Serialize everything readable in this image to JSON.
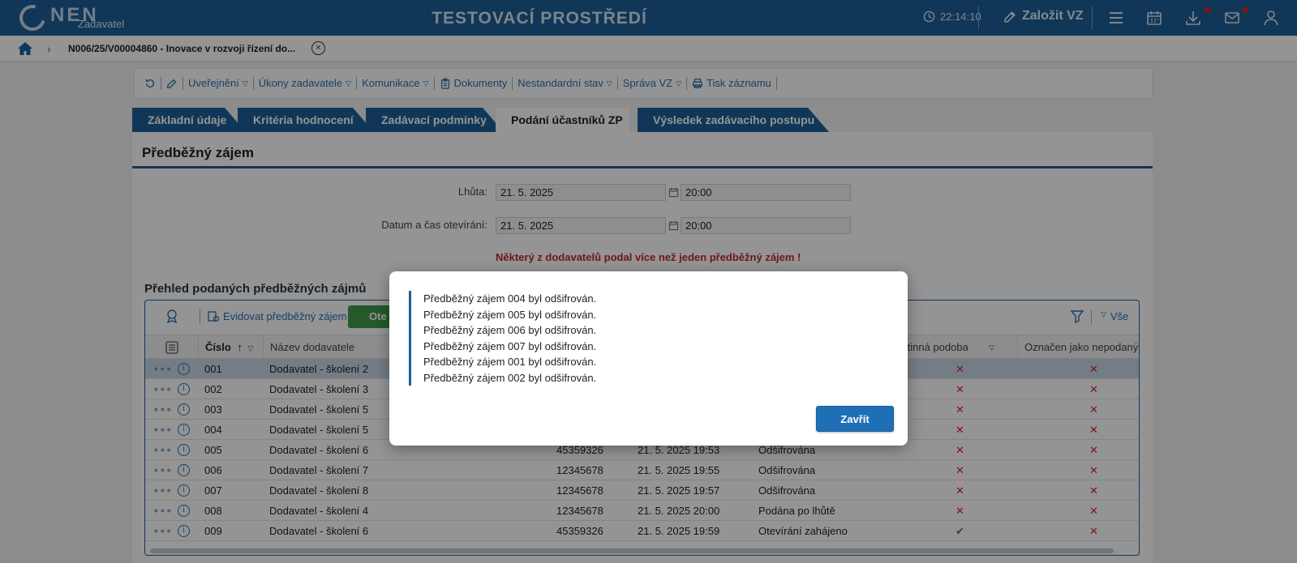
{
  "header": {
    "logo_text": "NEN",
    "logo_sub": "Zadavatel",
    "env_title": "TESTOVACÍ PROSTŘEDÍ",
    "time": "22:14:10",
    "create_label": "Založit VZ"
  },
  "breadcrumb": {
    "current": "N006/25/V00004860 - Inovace v rozvoji řízení do...",
    "close_symbol": "×"
  },
  "toolbar": {
    "items": [
      "Uveřejnění",
      "Úkony zadavatele",
      "Komunikace",
      "Dokumenty",
      "Nestandardní stav",
      "Správa VZ",
      "Tisk záznamu"
    ]
  },
  "tabs": [
    "Základní údaje",
    "Kritéria hodnocení",
    "Zadávací podmínky",
    "Podání účastníků ZP",
    "Výsledek zadávacího postupu"
  ],
  "section": {
    "title": "Předběžný zájem",
    "deadline_label": "Lhůta:",
    "deadline_date": "21. 5. 2025",
    "deadline_time": "20:00",
    "opening_label": "Datum a čas otevírání:",
    "opening_date": "21. 5. 2025",
    "opening_time": "20:00",
    "warning": "Některý z dodavatelů podal více než jeden předběžný zájem !"
  },
  "grid": {
    "title": "Přehled podaných předběžných zájmů",
    "register_label": "Evidovat předběžný zájem",
    "open_label": "Ote",
    "filter_all": "Vše",
    "headers": [
      "Číslo",
      "Název dodavatele",
      "Listinná podoba",
      "Označen jako nepodaný"
    ],
    "rows": [
      {
        "num": "001",
        "name": "Dodavatel - školení 2",
        "ico": "",
        "date": "",
        "state": "",
        "paper": "x",
        "unsub": "x"
      },
      {
        "num": "002",
        "name": "Dodavatel - školení 3",
        "ico": "",
        "date": "",
        "state": "",
        "paper": "x",
        "unsub": "x"
      },
      {
        "num": "003",
        "name": "Dodavatel - školení 5",
        "ico": "",
        "date": "",
        "state": "",
        "paper": "x",
        "unsub": "x"
      },
      {
        "num": "004",
        "name": "Dodavatel - školení 5",
        "ico": "",
        "date": "",
        "state": "",
        "paper": "x",
        "unsub": "x"
      },
      {
        "num": "005",
        "name": "Dodavatel - školení 6",
        "ico": "45359326",
        "date": "21. 5. 2025 19:53",
        "state": "Odšifrována",
        "paper": "x",
        "unsub": "x"
      },
      {
        "num": "006",
        "name": "Dodavatel - školení 7",
        "ico": "12345678",
        "date": "21. 5. 2025 19:55",
        "state": "Odšifrována",
        "paper": "x",
        "unsub": "x"
      },
      {
        "num": "007",
        "name": "Dodavatel - školení 8",
        "ico": "12345678",
        "date": "21. 5. 2025 19:57",
        "state": "Odšifrována",
        "paper": "x",
        "unsub": "x"
      },
      {
        "num": "008",
        "name": "Dodavatel - školení 4",
        "ico": "12345678",
        "date": "21. 5. 2025 20:00",
        "state": "Podána po lhůtě",
        "paper": "x",
        "unsub": "x"
      },
      {
        "num": "009",
        "name": "Dodavatel - školení 6",
        "ico": "45359326",
        "date": "21. 5. 2025 19:59",
        "state": "Otevírání zahájeno",
        "paper": "check",
        "unsub": "x"
      }
    ]
  },
  "modal": {
    "messages": [
      "Předběžný zájem 004 byl odšifrován.",
      "Předběžný zájem 005 byl odšifrován.",
      "Předběžný zájem 006 byl odšifrován.",
      "Předběžný zájem 007 byl odšifrován.",
      "Předběžný zájem 001 byl odšifrován.",
      "Předběžný zájem 002 byl odšifrován."
    ],
    "close_label": "Zavřít"
  },
  "colors": {
    "brand": "#1d5f97",
    "warning": "#c0282d",
    "button": "#1f6fb6"
  }
}
